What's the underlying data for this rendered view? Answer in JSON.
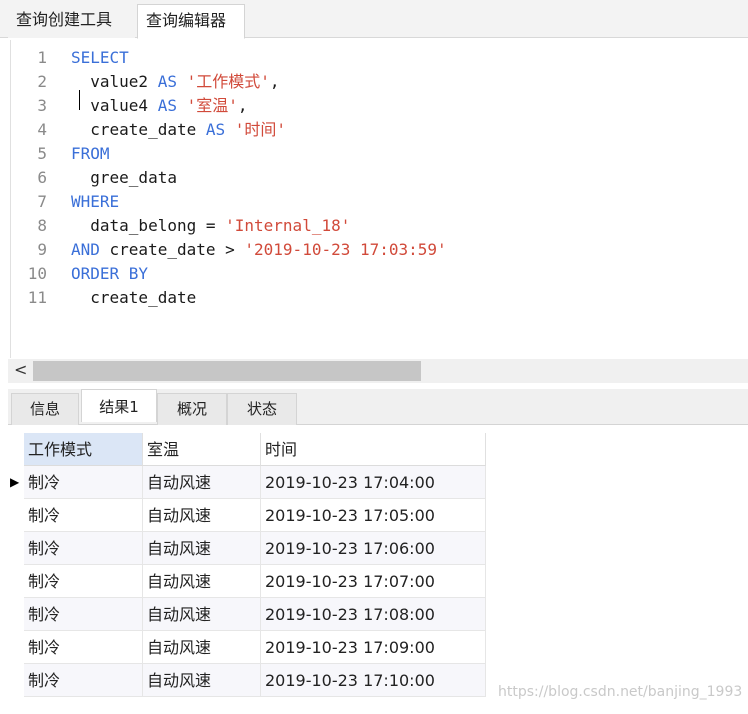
{
  "top_tabs": [
    "查询创建工具",
    "查询编辑器"
  ],
  "editor": {
    "lines": [
      {
        "n": "1",
        "tokens": [
          {
            "t": "SELECT",
            "c": "kw"
          }
        ]
      },
      {
        "n": "2",
        "tokens": [
          {
            "t": "  value2 ",
            "c": "id"
          },
          {
            "t": "AS ",
            "c": "kw"
          },
          {
            "t": "'工作模式'",
            "c": "str"
          },
          {
            "t": ",",
            "c": "id"
          }
        ]
      },
      {
        "n": "3",
        "tokens": [
          {
            "t": "  value4 ",
            "c": "id"
          },
          {
            "t": "AS ",
            "c": "kw"
          },
          {
            "t": "'室温'",
            "c": "str"
          },
          {
            "t": ",",
            "c": "id"
          }
        ]
      },
      {
        "n": "4",
        "tokens": [
          {
            "t": "  create_date ",
            "c": "id"
          },
          {
            "t": "AS ",
            "c": "kw"
          },
          {
            "t": "'时间'",
            "c": "str"
          }
        ]
      },
      {
        "n": "5",
        "tokens": [
          {
            "t": "FROM",
            "c": "kw"
          }
        ]
      },
      {
        "n": "6",
        "tokens": [
          {
            "t": "  gree_data",
            "c": "id"
          }
        ]
      },
      {
        "n": "7",
        "tokens": [
          {
            "t": "WHERE",
            "c": "kw"
          }
        ]
      },
      {
        "n": "8",
        "tokens": [
          {
            "t": "  data_belong = ",
            "c": "id"
          },
          {
            "t": "'Internal_18'",
            "c": "str"
          }
        ]
      },
      {
        "n": "9",
        "tokens": [
          {
            "t": "AND ",
            "c": "kw"
          },
          {
            "t": "create_date > ",
            "c": "id"
          },
          {
            "t": "'2019-10-23 17:03:59'",
            "c": "str"
          }
        ]
      },
      {
        "n": "10",
        "tokens": [
          {
            "t": "ORDER BY",
            "c": "kw"
          }
        ]
      },
      {
        "n": "11",
        "tokens": [
          {
            "t": "  create_date",
            "c": "id"
          }
        ]
      }
    ]
  },
  "scrollbar": {
    "left_arrow": "<"
  },
  "result_tabs": [
    "信息",
    "结果1",
    "概况",
    "状态"
  ],
  "grid": {
    "columns": [
      "工作模式",
      "室温",
      "时间"
    ],
    "rows": [
      [
        "制冷",
        "自动风速",
        "2019-10-23 17:04:00"
      ],
      [
        "制冷",
        "自动风速",
        "2019-10-23 17:05:00"
      ],
      [
        "制冷",
        "自动风速",
        "2019-10-23 17:06:00"
      ],
      [
        "制冷",
        "自动风速",
        "2019-10-23 17:07:00"
      ],
      [
        "制冷",
        "自动风速",
        "2019-10-23 17:08:00"
      ],
      [
        "制冷",
        "自动风速",
        "2019-10-23 17:09:00"
      ],
      [
        "制冷",
        "自动风速",
        "2019-10-23 17:10:00"
      ]
    ],
    "current_row_indicator": "▶"
  },
  "watermark": "https://blog.csdn.net/banjing_1993",
  "colors": {
    "keyword": "#3a6fd8",
    "string": "#d14a3a",
    "selected_header": "#dbe6f6"
  }
}
